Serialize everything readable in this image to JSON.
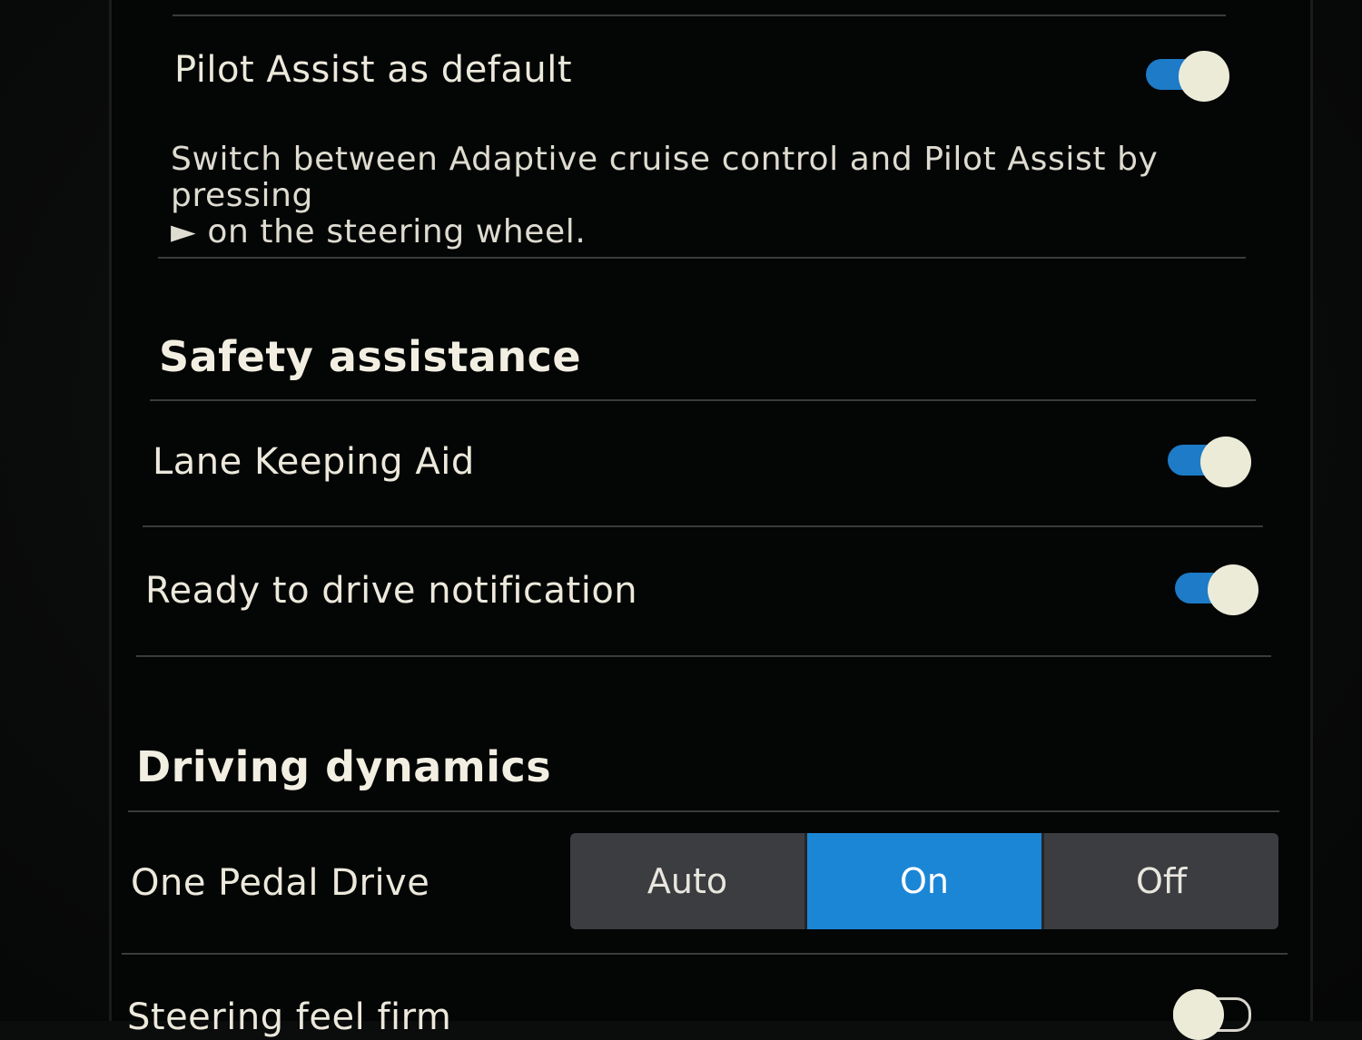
{
  "colors": {
    "accent": "#1c86d6",
    "toggle_on_track": "#1d7bc8",
    "toggle_knob": "#ecebd8",
    "text": "#ece9dc",
    "background": "#040505"
  },
  "pilot_assist": {
    "label": "Pilot Assist as default",
    "toggle_state": "on",
    "description_line1": "Switch between Adaptive cruise control and Pilot Assist by pressing",
    "description_line2": "► on the steering wheel."
  },
  "safety_assistance": {
    "title": "Safety assistance",
    "items": [
      {
        "label": "Lane Keeping Aid",
        "toggle_state": "on"
      },
      {
        "label": "Ready to drive notification",
        "toggle_state": "on"
      }
    ]
  },
  "driving_dynamics": {
    "title": "Driving dynamics",
    "one_pedal_drive": {
      "label": "One Pedal Drive",
      "options": [
        "Auto",
        "On",
        "Off"
      ],
      "selected": "On"
    },
    "steering_feel": {
      "label": "Steering feel firm",
      "toggle_state": "off"
    }
  }
}
